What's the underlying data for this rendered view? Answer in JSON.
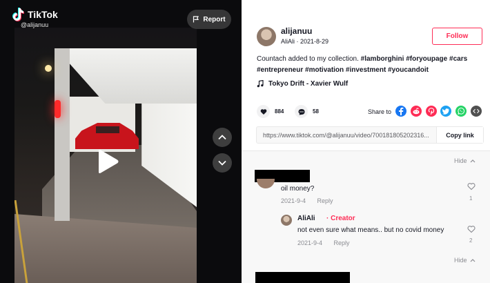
{
  "brand": {
    "name": "TikTok",
    "handle": "@alijanuu"
  },
  "video": {
    "report_label": "Report"
  },
  "author": {
    "username": "alijanuu",
    "meta": "AliAli · 2021-8-29",
    "follow_label": "Follow"
  },
  "caption": {
    "text": "Countach added to my collection.",
    "hashtags_line1": "#lamborghini #foryoupage #cars",
    "hashtags_line2": "#entrepreneur #motivation #investment #youcandoit"
  },
  "music": {
    "title": "Tokyo Drift - Xavier Wulf"
  },
  "stats": {
    "likes": "884",
    "comments": "58"
  },
  "share": {
    "label": "Share to",
    "icons": [
      "facebook-icon",
      "reddit-icon",
      "pinterest-icon",
      "twitter-icon",
      "whatsapp-icon",
      "embed-icon"
    ]
  },
  "link": {
    "url": "https://www.tiktok.com/@alijanuu/video/700181805202316...",
    "copy_label": "Copy link"
  },
  "comments": {
    "hide_label": "Hide",
    "items": [
      {
        "text": "oil money?",
        "date": "2021-9-4",
        "reply_label": "Reply",
        "likes": "1",
        "replies": [
          {
            "author": "AliAli",
            "badge": " · Creator",
            "text": "not even sure what means.. but no covid money",
            "date": "2021-9-4",
            "reply_label": "Reply",
            "likes": "2"
          }
        ]
      }
    ]
  },
  "colors": {
    "accent": "#fe2c55",
    "muted": "#8a8b91",
    "panel_bg": "#f8f8f8"
  }
}
